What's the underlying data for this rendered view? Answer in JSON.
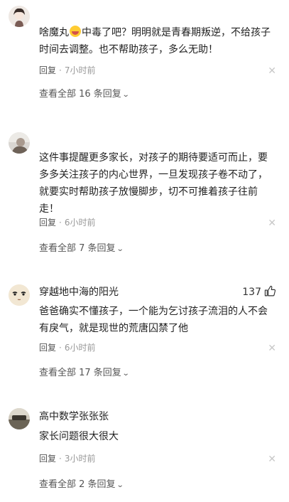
{
  "comments": [
    {
      "name": "",
      "text_before_emoji": "啥魔丸",
      "emoji": "dizzy-face-emoji",
      "text_after_emoji": "中毒了吧？明明就是青春期叛逆，不给孩子时间去调整。也不帮助孩子，多么无助！",
      "reply_label": "回复",
      "time": "7小时前",
      "more_label": "查看全部 16 条回复"
    },
    {
      "name": "",
      "text": "这件事提醒更多家长，对孩子的期待要适可而止，要多多关注孩子的内心世界，一旦发现孩子卷不动了，就要实时帮助孩子放慢脚步，切不可推着孩子往前走！",
      "reply_label": "回复",
      "time": "6小时前",
      "more_label": "查看全部 7 条回复"
    },
    {
      "name": "穿越地中海的阳光",
      "likes": "137",
      "text": "爸爸确实不懂孩子，一个能为乞讨孩子流泪的人不会有戾气，就是现世的荒唐囚禁了他",
      "reply_label": "回复",
      "time": "6小时前",
      "more_label": "查看全部 17 条回复"
    },
    {
      "name": "高中数学张张张",
      "text": "家长问题很大很大",
      "reply_label": "回复",
      "time": "3小时前",
      "more_label": "查看全部 2 条回复"
    }
  ],
  "icons": {
    "close": "close-icon",
    "chevron": "chevron-down-icon",
    "like": "thumbs-up-icon"
  },
  "glyphs": {
    "close": "✕",
    "chevron": "⌄"
  }
}
